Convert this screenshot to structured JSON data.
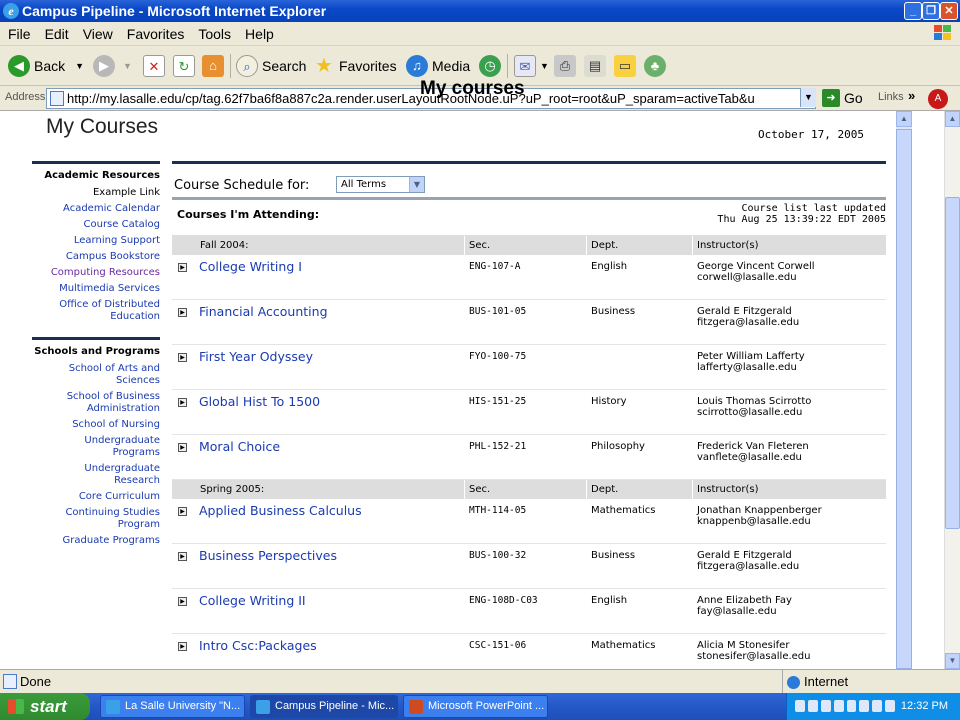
{
  "window": {
    "title": "Campus Pipeline - Microsoft Internet Explorer"
  },
  "menu": [
    "File",
    "Edit",
    "View",
    "Favorites",
    "Tools",
    "Help"
  ],
  "toolbar": {
    "back": "Back",
    "search": "Search",
    "favorites": "Favorites",
    "media": "Media"
  },
  "address": {
    "label": "Address",
    "url": "http://my.lasalle.edu/cp/tag.62f7ba6f8a887c2a.render.userLayoutRootNode.uP?uP_root=root&uP_sparam=activeTab&u",
    "go": "Go",
    "links": "Links"
  },
  "caption": "My courses",
  "page": {
    "title": "My Courses",
    "date": "October 17, 2005",
    "schedule_label": "Course Schedule for:",
    "term_selected": "All Terms",
    "attending_label": "Courses I'm Attending:",
    "updated_line1": "Course list last updated",
    "updated_line2": "Thu Aug 25 13:39:22 EDT 2005"
  },
  "sidebar": {
    "academic_head": "Academic Resources",
    "academic_items": [
      "Example Link",
      "Academic Calendar",
      "Course Catalog",
      "Learning Support",
      "Campus Bookstore",
      "Computing Resources",
      "Multimedia Services",
      "Office of Distributed Education"
    ],
    "schools_head": "Schools and Programs",
    "schools_items": [
      "School of Arts and Sciences",
      "School of Business Administration",
      "School of Nursing",
      "Undergraduate Programs",
      "Undergraduate Research",
      "Core Curriculum",
      "Continuing Studies Program",
      "Graduate Programs"
    ]
  },
  "terms": [
    {
      "name": "Fall 2004:",
      "sec_h": "Sec.",
      "dept_h": "Dept.",
      "instr_h": "Instructor(s)",
      "courses": [
        {
          "title": "College Writing I",
          "sec": "ENG-107-A",
          "dept": "English",
          "instructor": "George Vincent Corwell",
          "email": "corwell@lasalle.edu"
        },
        {
          "title": "Financial Accounting",
          "sec": "BUS-101-05",
          "dept": "Business",
          "instructor": "Gerald E Fitzgerald",
          "email": "fitzgera@lasalle.edu"
        },
        {
          "title": "First Year Odyssey",
          "sec": "FYO-100-75",
          "dept": "",
          "instructor": "Peter William Lafferty",
          "email": "lafferty@lasalle.edu"
        },
        {
          "title": "Global Hist To 1500",
          "sec": "HIS-151-25",
          "dept": "History",
          "instructor": "Louis Thomas Scirrotto",
          "email": "scirrotto@lasalle.edu"
        },
        {
          "title": "Moral Choice",
          "sec": "PHL-152-21",
          "dept": "Philosophy",
          "instructor": "Frederick Van Fleteren",
          "email": "vanflete@lasalle.edu"
        }
      ]
    },
    {
      "name": "Spring 2005:",
      "sec_h": "Sec.",
      "dept_h": "Dept.",
      "instr_h": "Instructor(s)",
      "courses": [
        {
          "title": "Applied Business Calculus",
          "sec": "MTH-114-05",
          "dept": "Mathematics",
          "instructor": "Jonathan Knappenberger",
          "email": "knappenb@lasalle.edu"
        },
        {
          "title": "Business Perspectives",
          "sec": "BUS-100-32",
          "dept": "Business",
          "instructor": "Gerald E Fitzgerald",
          "email": "fitzgera@lasalle.edu"
        },
        {
          "title": "College Writing II",
          "sec": "ENG-108D-C03",
          "dept": "English",
          "instructor": "Anne Elizabeth Fay",
          "email": "fay@lasalle.edu"
        },
        {
          "title": "Intro Csc:Packages",
          "sec": "CSC-151-06",
          "dept": "Mathematics",
          "instructor": "Alicia M Stonesifer",
          "email": "stonesifer@lasalle.edu"
        }
      ]
    }
  ],
  "status": {
    "done": "Done",
    "zone": "Internet"
  },
  "taskbar": {
    "start": "start",
    "tasks": [
      "La Salle University \"N...",
      "Campus Pipeline - Mic...",
      "Microsoft PowerPoint ..."
    ],
    "clock": "12:32 PM"
  }
}
